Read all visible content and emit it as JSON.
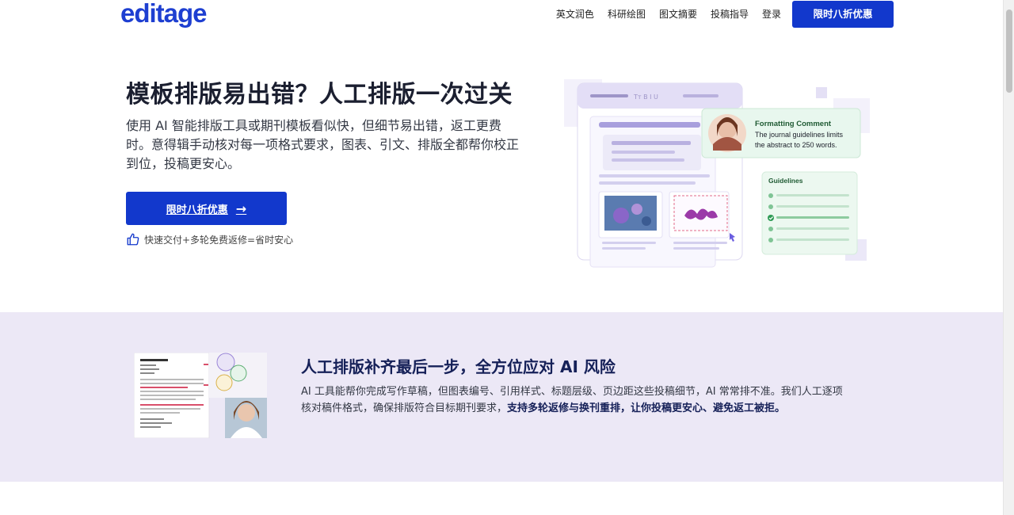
{
  "header": {
    "logo": "editage",
    "nav": [
      {
        "label": "英文润色"
      },
      {
        "label": "科研绘图"
      },
      {
        "label": "图文摘要"
      },
      {
        "label": "投稿指导"
      },
      {
        "label": "登录"
      }
    ],
    "cta_label": "限时八折优惠"
  },
  "hero": {
    "title": "模板排版易出错？人工排版一次过关",
    "description": "使用 AI 智能排版工具或期刊模板看似快，但细节易出错，返工更费时。意得辑手动核对每一项格式要求，图表、引文、排版全都帮你校正到位，投稿更安心。",
    "cta_label": "限时八折优惠",
    "note": "快速交付+多轮免费返修=省时安心"
  },
  "illustration": {
    "comment_title": "Formatting Comment",
    "comment_line1": "The journal guidelines limits",
    "comment_line2": "the abstract to 250 words.",
    "guidelines_title": "Guidelines",
    "toolbar_text": "Tт  B  I  U"
  },
  "band": {
    "title": "人工排版补齐最后一步，全方位应对 AI 风险",
    "desc_plain": "AI 工具能帮你完成写作草稿，但图表编号、引用样式、标题层级、页边距这些投稿细节，AI 常常排不准。我们人工逐项核对稿件格式，确保排版符合目标期刊要求，",
    "desc_bold": "支持多轮返修与换刊重排，让你投稿更安心、避免返工被拒。"
  },
  "colors": {
    "brand_blue": "#1238cc",
    "logo_blue": "#1e3fd1",
    "band_bg": "#ece8f6",
    "band_title": "#152058"
  }
}
